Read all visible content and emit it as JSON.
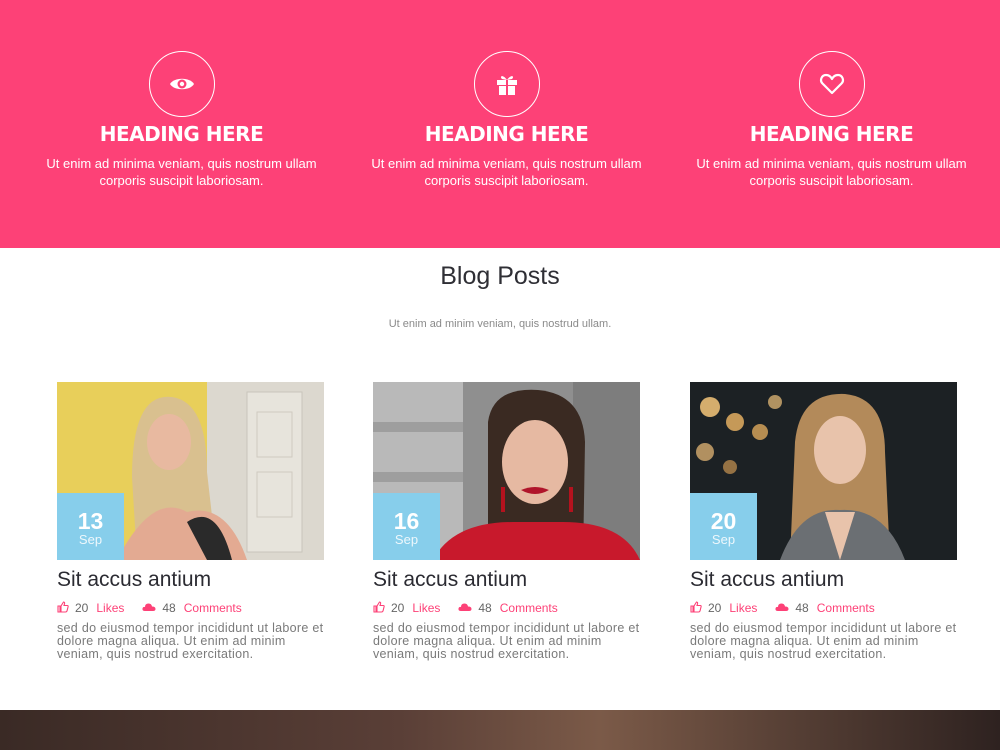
{
  "features": [
    {
      "icon": "eye-icon",
      "title": "HEADING HERE",
      "text": "Ut enim ad minima veniam, quis nostrum ullam corporis suscipit laboriosam."
    },
    {
      "icon": "gift-icon",
      "title": "HEADING HERE",
      "text": "Ut enim ad minima veniam, quis nostrum ullam corporis suscipit laboriosam."
    },
    {
      "icon": "heart-icon",
      "title": "HEADING HERE",
      "text": "Ut enim ad minima veniam, quis nostrum ullam corporis suscipit laboriosam."
    }
  ],
  "blog": {
    "title": "Blog Posts",
    "subtitle": "Ut enim ad minim veniam, quis nostrud ullam."
  },
  "posts": [
    {
      "day": "13",
      "month": "Sep",
      "title": "Sit accus antium",
      "likes": "20",
      "likes_label": "Likes",
      "comments": "48",
      "comments_label": "Comments",
      "excerpt": "sed do eiusmod tempor incididunt ut labore et dolore magna aliqua. Ut enim ad minim veniam, quis nostrud exercitation."
    },
    {
      "day": "16",
      "month": "Sep",
      "title": "Sit accus antium",
      "likes": "20",
      "likes_label": "Likes",
      "comments": "48",
      "comments_label": "Comments",
      "excerpt": "sed do eiusmod tempor incididunt ut labore et dolore magna aliqua. Ut enim ad minim veniam, quis nostrud exercitation."
    },
    {
      "day": "20",
      "month": "Sep",
      "title": "Sit accus antium",
      "likes": "20",
      "likes_label": "Likes",
      "comments": "48",
      "comments_label": "Comments",
      "excerpt": "sed do eiusmod tempor incididunt ut labore et dolore magna aliqua. Ut enim ad minim veniam, quis nostrud exercitation."
    }
  ],
  "colors": {
    "accent": "#fd4177",
    "date_badge": "#87ceeb",
    "heading": "#2f2f35",
    "muted": "#8a8a8a"
  }
}
